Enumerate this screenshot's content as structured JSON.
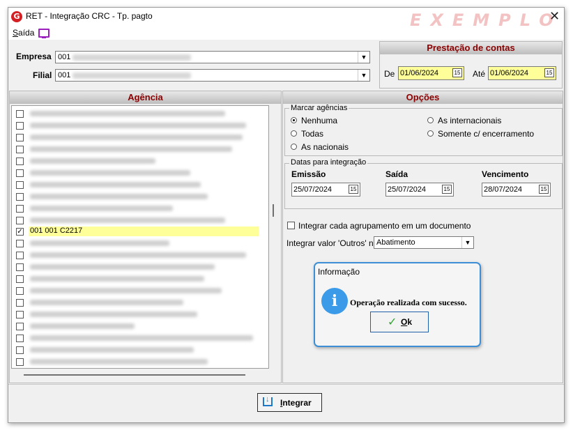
{
  "window": {
    "title": "RET - Integração CRC - Tp. pagto",
    "watermark": "EXEMPLO",
    "close": "✕"
  },
  "menu": {
    "saida_pre": "",
    "saida_u": "S",
    "saida_rest": "aída"
  },
  "empresa": {
    "label": "Empresa",
    "value": "001"
  },
  "filial": {
    "label": "Filial",
    "value": "001"
  },
  "prestacao": {
    "title": "Prestação de contas",
    "de_label": "De",
    "de_value": "01/06/2024",
    "ate_label": "Até",
    "ate_value": "01/06/2024"
  },
  "agencia": {
    "title": "Agência",
    "selected_item": "001 001 C2217"
  },
  "opcoes": {
    "title": "Opções",
    "marcar_title": "Marcar agências",
    "radios": {
      "nenhuma": "Nenhuma",
      "todas": "Todas",
      "nacionais": "As nacionais",
      "internacionais": "As internacionais",
      "encerramento": "Somente c/ encerramento"
    },
    "datas_title": "Datas para integração",
    "emissao_label": "Emissão",
    "emissao_value": "25/07/2024",
    "saida_label": "Saída",
    "saida_value": "25/07/2024",
    "vencimento_label": "Vencimento",
    "vencimento_value": "28/07/2024",
    "integrar_cada": "Integrar cada agrupamento em um documento",
    "integrar_outros_label": "Integrar valor 'Outros' no",
    "integrar_outros_value": "Abatimento"
  },
  "dialog": {
    "title": "Informação",
    "message": "Operação realizada com sucesso.",
    "ok_u": "O",
    "ok_rest": "k"
  },
  "integrar_btn": {
    "u": "I",
    "rest": "ntegrar"
  },
  "colors": {
    "header_text": "#8b0000",
    "highlight": "#ffff9a",
    "dialog_border": "#3c8fd6"
  }
}
